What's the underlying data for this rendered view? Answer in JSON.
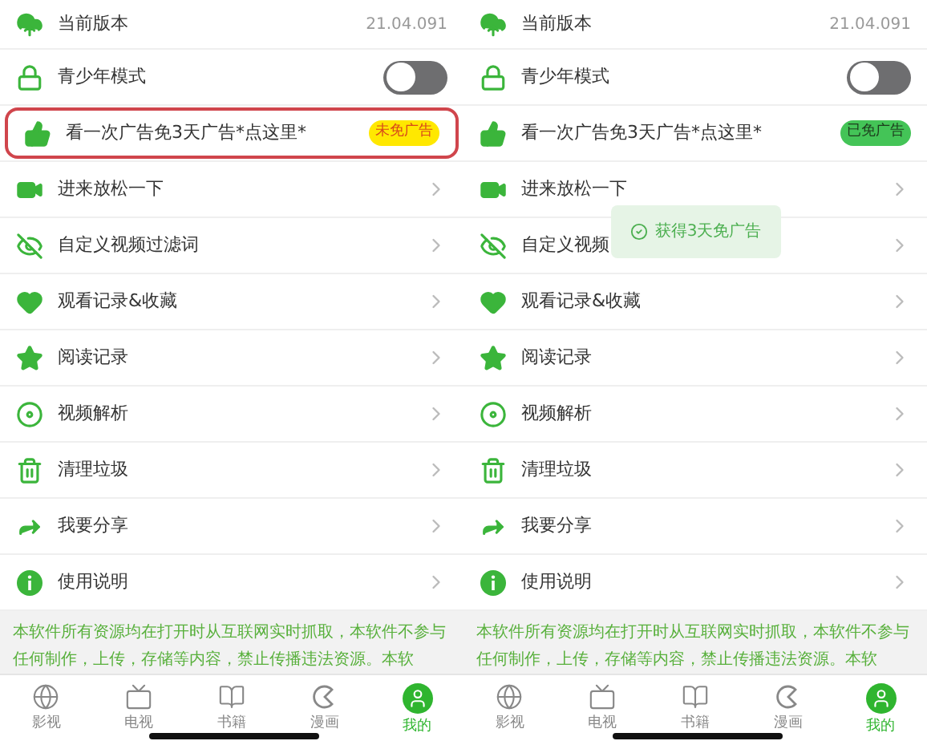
{
  "panels": [
    {
      "rows": [
        {
          "kind": "value",
          "label": "当前版本",
          "value": "21.04.091"
        },
        {
          "kind": "toggle",
          "label": "青少年模式",
          "on": false
        },
        {
          "kind": "badge",
          "label": "看一次广告免3天广告*点这里*",
          "highlighted": true,
          "badge": {
            "text": "未免广告",
            "ad_free": false
          }
        },
        {
          "kind": "link",
          "label": "进来放松一下"
        },
        {
          "kind": "link",
          "label": "自定义视频过滤词"
        },
        {
          "kind": "link",
          "label": "观看记录&收藏"
        },
        {
          "kind": "link",
          "label": "阅读记录"
        },
        {
          "kind": "link",
          "label": "视频解析"
        },
        {
          "kind": "link",
          "label": "清理垃圾"
        },
        {
          "kind": "link",
          "label": "我要分享"
        },
        {
          "kind": "link",
          "label": "使用说明"
        }
      ],
      "notice": "本软件所有资源均在打开时从互联网实时抓取，本软件不参与任何制作，上传，存储等内容，禁止传播违法资源。本软",
      "tabs": [
        {
          "label": "影视",
          "selected": false
        },
        {
          "label": "电视",
          "selected": false
        },
        {
          "label": "书籍",
          "selected": false
        },
        {
          "label": "漫画",
          "selected": false
        },
        {
          "label": "我的",
          "selected": true
        }
      ]
    },
    {
      "rows": [
        {
          "kind": "value",
          "label": "当前版本",
          "value": "21.04.091"
        },
        {
          "kind": "toggle",
          "label": "青少年模式",
          "on": false
        },
        {
          "kind": "badge",
          "label": "看一次广告免3天广告*点这里*",
          "highlighted": false,
          "badge": {
            "text": "已免广告",
            "ad_free": true
          }
        },
        {
          "kind": "link",
          "label": "进来放松一下"
        },
        {
          "kind": "link",
          "label": "自定义视频"
        },
        {
          "kind": "link",
          "label": "观看记录&收藏"
        },
        {
          "kind": "link",
          "label": "阅读记录"
        },
        {
          "kind": "link",
          "label": "视频解析"
        },
        {
          "kind": "link",
          "label": "清理垃圾"
        },
        {
          "kind": "link",
          "label": "我要分享"
        },
        {
          "kind": "link",
          "label": "使用说明"
        }
      ],
      "toast": "获得3天免广告",
      "notice": "本软件所有资源均在打开时从互联网实时抓取，本软件不参与任何制作，上传，存储等内容，禁止传播违法资源。本软",
      "tabs": [
        {
          "label": "影视",
          "selected": false
        },
        {
          "label": "电视",
          "selected": false
        },
        {
          "label": "书籍",
          "selected": false
        },
        {
          "label": "漫画",
          "selected": false
        },
        {
          "label": "我的",
          "selected": true
        }
      ]
    }
  ]
}
